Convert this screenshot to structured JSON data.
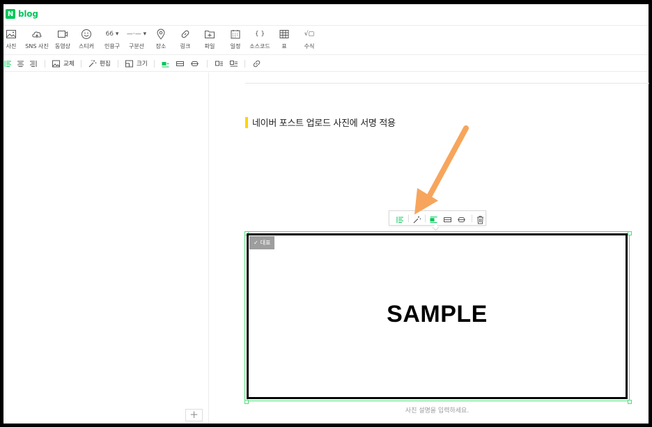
{
  "app": {
    "logo_letter": "N",
    "logo_text": "blog",
    "brand_color": "#03c75a"
  },
  "toolbar": {
    "items": [
      {
        "label": "사진",
        "icon": "photo-icon"
      },
      {
        "label": "SNS 사진",
        "icon": "cloud-icon"
      },
      {
        "label": "동영상",
        "icon": "video-icon"
      },
      {
        "label": "스티커",
        "icon": "smile-icon"
      },
      {
        "label": "인용구",
        "icon": "quote-icon",
        "glyph": "66 ▾"
      },
      {
        "label": "구분선",
        "icon": "divider-icon",
        "glyph": "—·— ▾"
      },
      {
        "label": "장소",
        "icon": "location-icon"
      },
      {
        "label": "링크",
        "icon": "link-icon"
      },
      {
        "label": "파일",
        "icon": "file-icon"
      },
      {
        "label": "일정",
        "icon": "calendar-icon"
      },
      {
        "label": "소스코드",
        "icon": "code-icon",
        "glyph": "{ }"
      },
      {
        "label": "표",
        "icon": "table-icon"
      },
      {
        "label": "수식",
        "icon": "formula-icon",
        "glyph": "√▢"
      }
    ]
  },
  "format_bar": {
    "replace_label": "교체",
    "edit_label": "편집",
    "size_label": "크기"
  },
  "editor": {
    "title": "네이버 포스트 업로드 사진에 서명 적용",
    "title_accent": "#ffd400",
    "image": {
      "badge_label": "대표",
      "sample_text": "SAMPLE",
      "caption_placeholder": "사진 설명을 입력하세요.",
      "selection_color": "#4fdc7c"
    },
    "arrow_color": "#f7a55c"
  },
  "left_panel": {
    "add_label": "+"
  }
}
